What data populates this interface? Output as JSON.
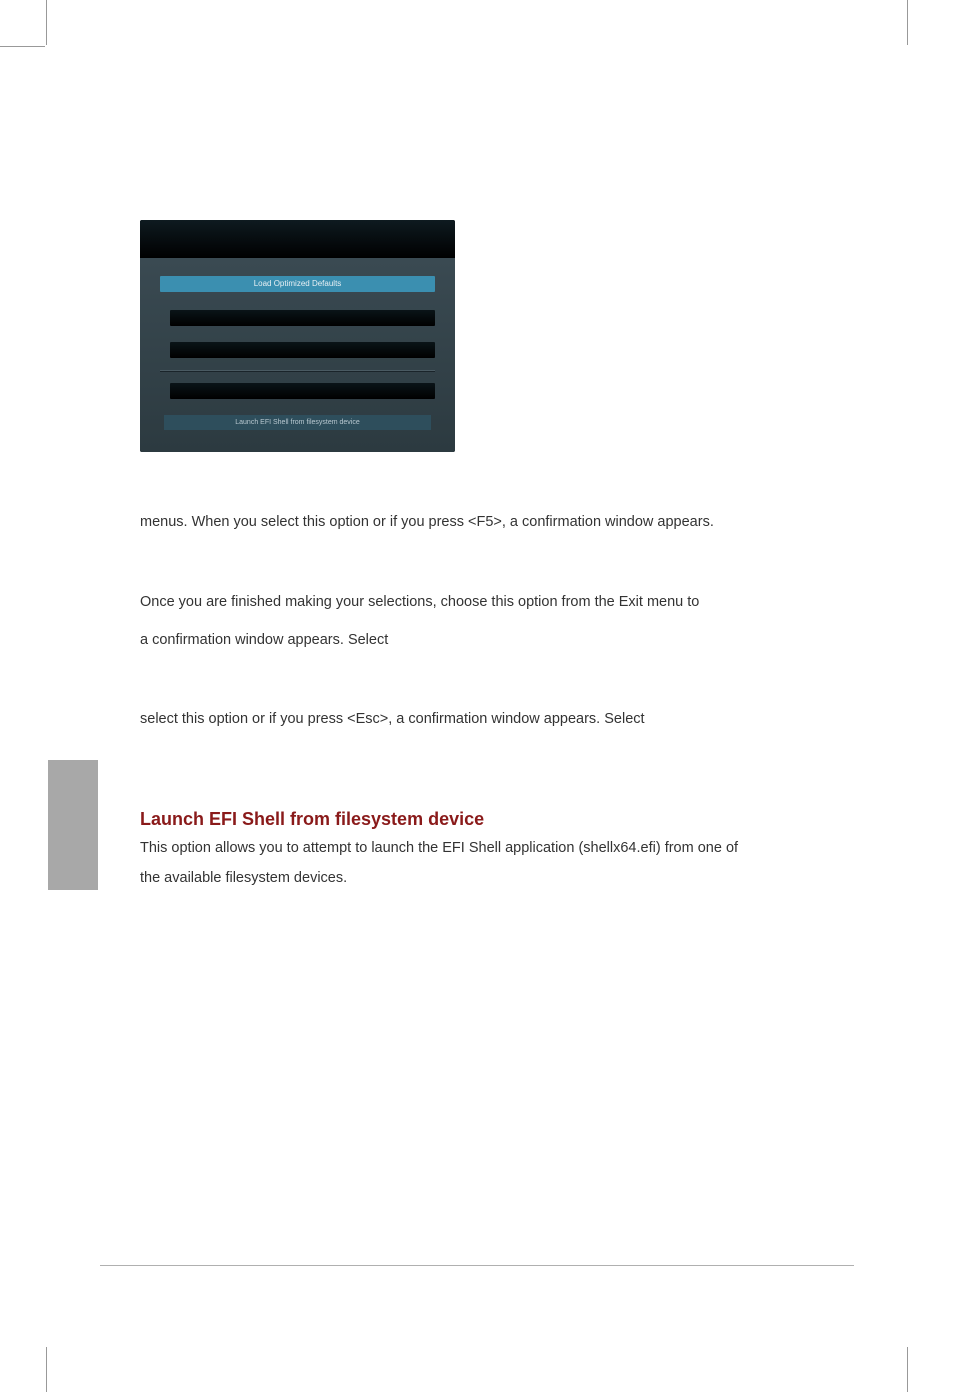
{
  "bios": {
    "item_selected": "Load Optimized Defaults",
    "item_launch": "Launch EFI Shell from filesystem device"
  },
  "paragraphs": {
    "p1": "menus. When you select this option or if you press <F5>, a confirmation window appears.",
    "p2": "Once you are finished making your selections, choose this option from the Exit menu to",
    "p3": "a confirmation window appears. Select",
    "p4": "select this option or if you press <Esc>, a confirmation window appears. Select"
  },
  "heading": {
    "launch_efi": "Launch EFI Shell from filesystem device"
  },
  "body": {
    "efi1": "This option allows you to attempt to launch the EFI Shell application (shellx64.efi) from one of",
    "efi2": "the available filesystem devices."
  }
}
